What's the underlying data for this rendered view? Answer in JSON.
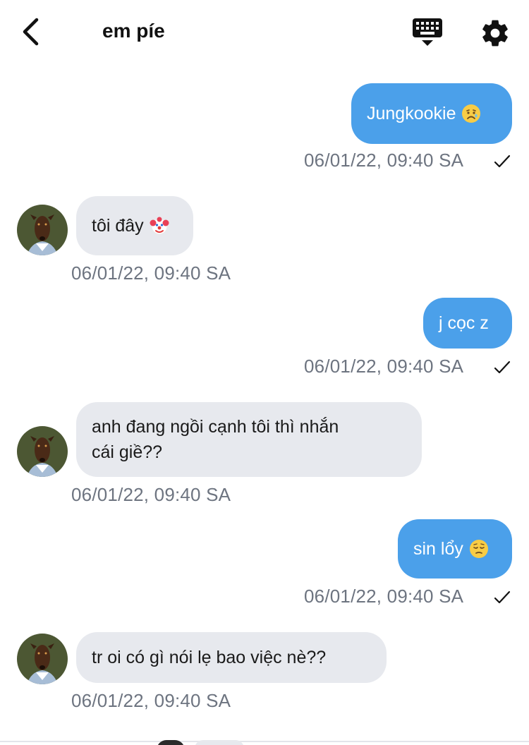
{
  "header": {
    "title": "em píe"
  },
  "messages": [
    {
      "direction": "out",
      "text": "Jungkookie",
      "emoji": "worried-face-emoji",
      "timestamp": "06/01/22, 09:40 SA",
      "read": true
    },
    {
      "direction": "in",
      "text": "tôi đây",
      "emoji": "clown-face-emoji",
      "timestamp": "06/01/22, 09:40 SA"
    },
    {
      "direction": "out",
      "text": "j cọc z",
      "timestamp": "06/01/22, 09:40 SA",
      "read": true
    },
    {
      "direction": "in",
      "text_line1": "anh đang ngồi cạnh tôi thì nhắn",
      "text_line2": "cái giề??",
      "timestamp": "06/01/22, 09:40 SA"
    },
    {
      "direction": "out",
      "text": "sin lổy",
      "emoji": "pensive-face-emoji",
      "timestamp": "06/01/22, 09:40 SA",
      "read": true
    },
    {
      "direction": "in",
      "text": "tr oi có gì nói lẹ bao việc nè??",
      "timestamp": "06/01/22, 09:40 SA"
    }
  ],
  "colors": {
    "outgoing_bubble": "#4ba0ea",
    "incoming_bubble": "#e7e9ee",
    "timestamp": "#6d7480"
  }
}
